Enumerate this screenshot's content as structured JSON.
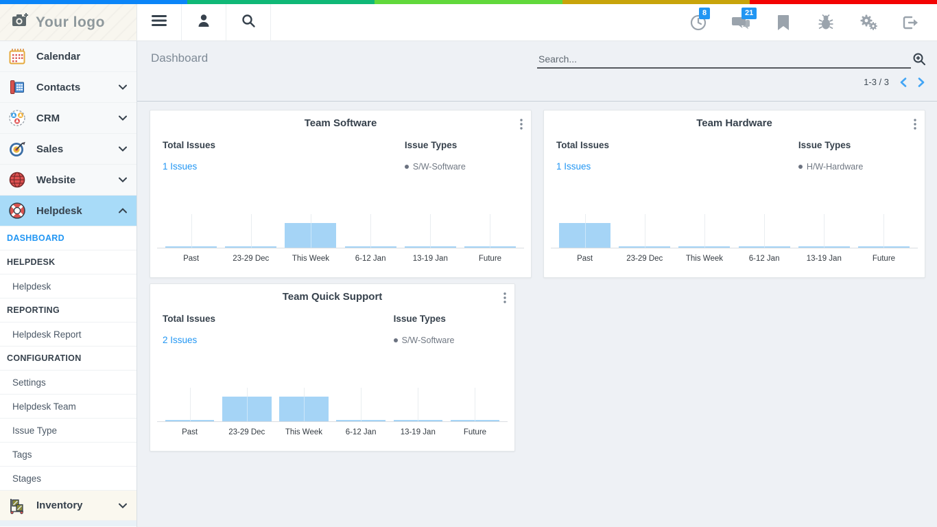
{
  "colors": {
    "accent": "#2196f3",
    "badge": "#2196f3",
    "active_bg": "#a8dbf8",
    "bar": "#a5d4f6"
  },
  "top_strip": {
    "colors": [
      "#0b85f8",
      "#10b877",
      "#61d83b",
      "#c8a40a",
      "#f30303"
    ]
  },
  "topbar": {
    "logo_text": "Your logo",
    "nav_icons": [
      "menu",
      "user",
      "search"
    ],
    "right_icons": [
      {
        "name": "recent-clock",
        "badge": "8"
      },
      {
        "name": "chat",
        "badge": "21"
      },
      {
        "name": "bookmark",
        "badge": ""
      },
      {
        "name": "bug-report",
        "badge": ""
      },
      {
        "name": "settings-gears",
        "badge": ""
      },
      {
        "name": "logout",
        "badge": ""
      }
    ]
  },
  "sidebar": {
    "items": [
      {
        "label": "Calendar"
      },
      {
        "label": "Contacts"
      },
      {
        "label": "CRM"
      },
      {
        "label": "Sales"
      },
      {
        "label": "Website"
      },
      {
        "label": "Helpdesk"
      }
    ],
    "submenu": [
      {
        "label": "DASHBOARD",
        "type": "active-link"
      },
      {
        "label": "HELPDESK",
        "type": "section"
      },
      {
        "label": "Helpdesk",
        "type": "link"
      },
      {
        "label": "REPORTING",
        "type": "section"
      },
      {
        "label": "Helpdesk Report",
        "type": "link"
      },
      {
        "label": "CONFIGURATION",
        "type": "section"
      },
      {
        "label": "Settings",
        "type": "link"
      },
      {
        "label": "Helpdesk Team",
        "type": "link"
      },
      {
        "label": "Issue Type",
        "type": "link"
      },
      {
        "label": "Tags",
        "type": "link"
      },
      {
        "label": "Stages",
        "type": "link"
      }
    ],
    "bottom_item": {
      "label": "Inventory"
    }
  },
  "header": {
    "title": "Dashboard",
    "search_placeholder": "Search...",
    "pagination": "1-3 / 3"
  },
  "cards": [
    {
      "title": "Team Software",
      "left_label": "Total Issues",
      "total_link": "1 Issues",
      "right_label": "Issue Types",
      "legend": "S/W-Software"
    },
    {
      "title": "Team Hardware",
      "left_label": "Total Issues",
      "total_link": "1 Issues",
      "right_label": "Issue Types",
      "legend": "H/W-Hardware"
    },
    {
      "title": "Team Quick Support",
      "left_label": "Total Issues",
      "total_link": "2 Issues",
      "right_label": "Issue Types",
      "legend": "S/W-Software"
    }
  ],
  "chart_data": [
    {
      "type": "bar",
      "title": "Team Software",
      "categories": [
        "Past",
        "23-29 Dec",
        "This Week",
        "6-12 Jan",
        "13-19 Jan",
        "Future"
      ],
      "values": [
        0,
        0,
        1,
        0,
        0,
        0
      ],
      "ylim": [
        0,
        1
      ],
      "bar_color": "#a5d4f6",
      "legend": [
        "S/W-Software"
      ],
      "legend_position": "top-right",
      "grid": "vertical-ticks"
    },
    {
      "type": "bar",
      "title": "Team Hardware",
      "categories": [
        "Past",
        "23-29 Dec",
        "This Week",
        "6-12 Jan",
        "13-19 Jan",
        "Future"
      ],
      "values": [
        1,
        0,
        0,
        0,
        0,
        0
      ],
      "ylim": [
        0,
        1
      ],
      "bar_color": "#a5d4f6",
      "legend": [
        "H/W-Hardware"
      ],
      "legend_position": "top-right",
      "grid": "vertical-ticks"
    },
    {
      "type": "bar",
      "title": "Team Quick Support",
      "categories": [
        "Past",
        "23-29 Dec",
        "This Week",
        "6-12 Jan",
        "13-19 Jan",
        "Future"
      ],
      "values": [
        0,
        1,
        1,
        0,
        0,
        0
      ],
      "ylim": [
        0,
        1
      ],
      "bar_color": "#a5d4f6",
      "legend": [
        "S/W-Software"
      ],
      "legend_position": "top-right",
      "grid": "vertical-ticks"
    }
  ]
}
